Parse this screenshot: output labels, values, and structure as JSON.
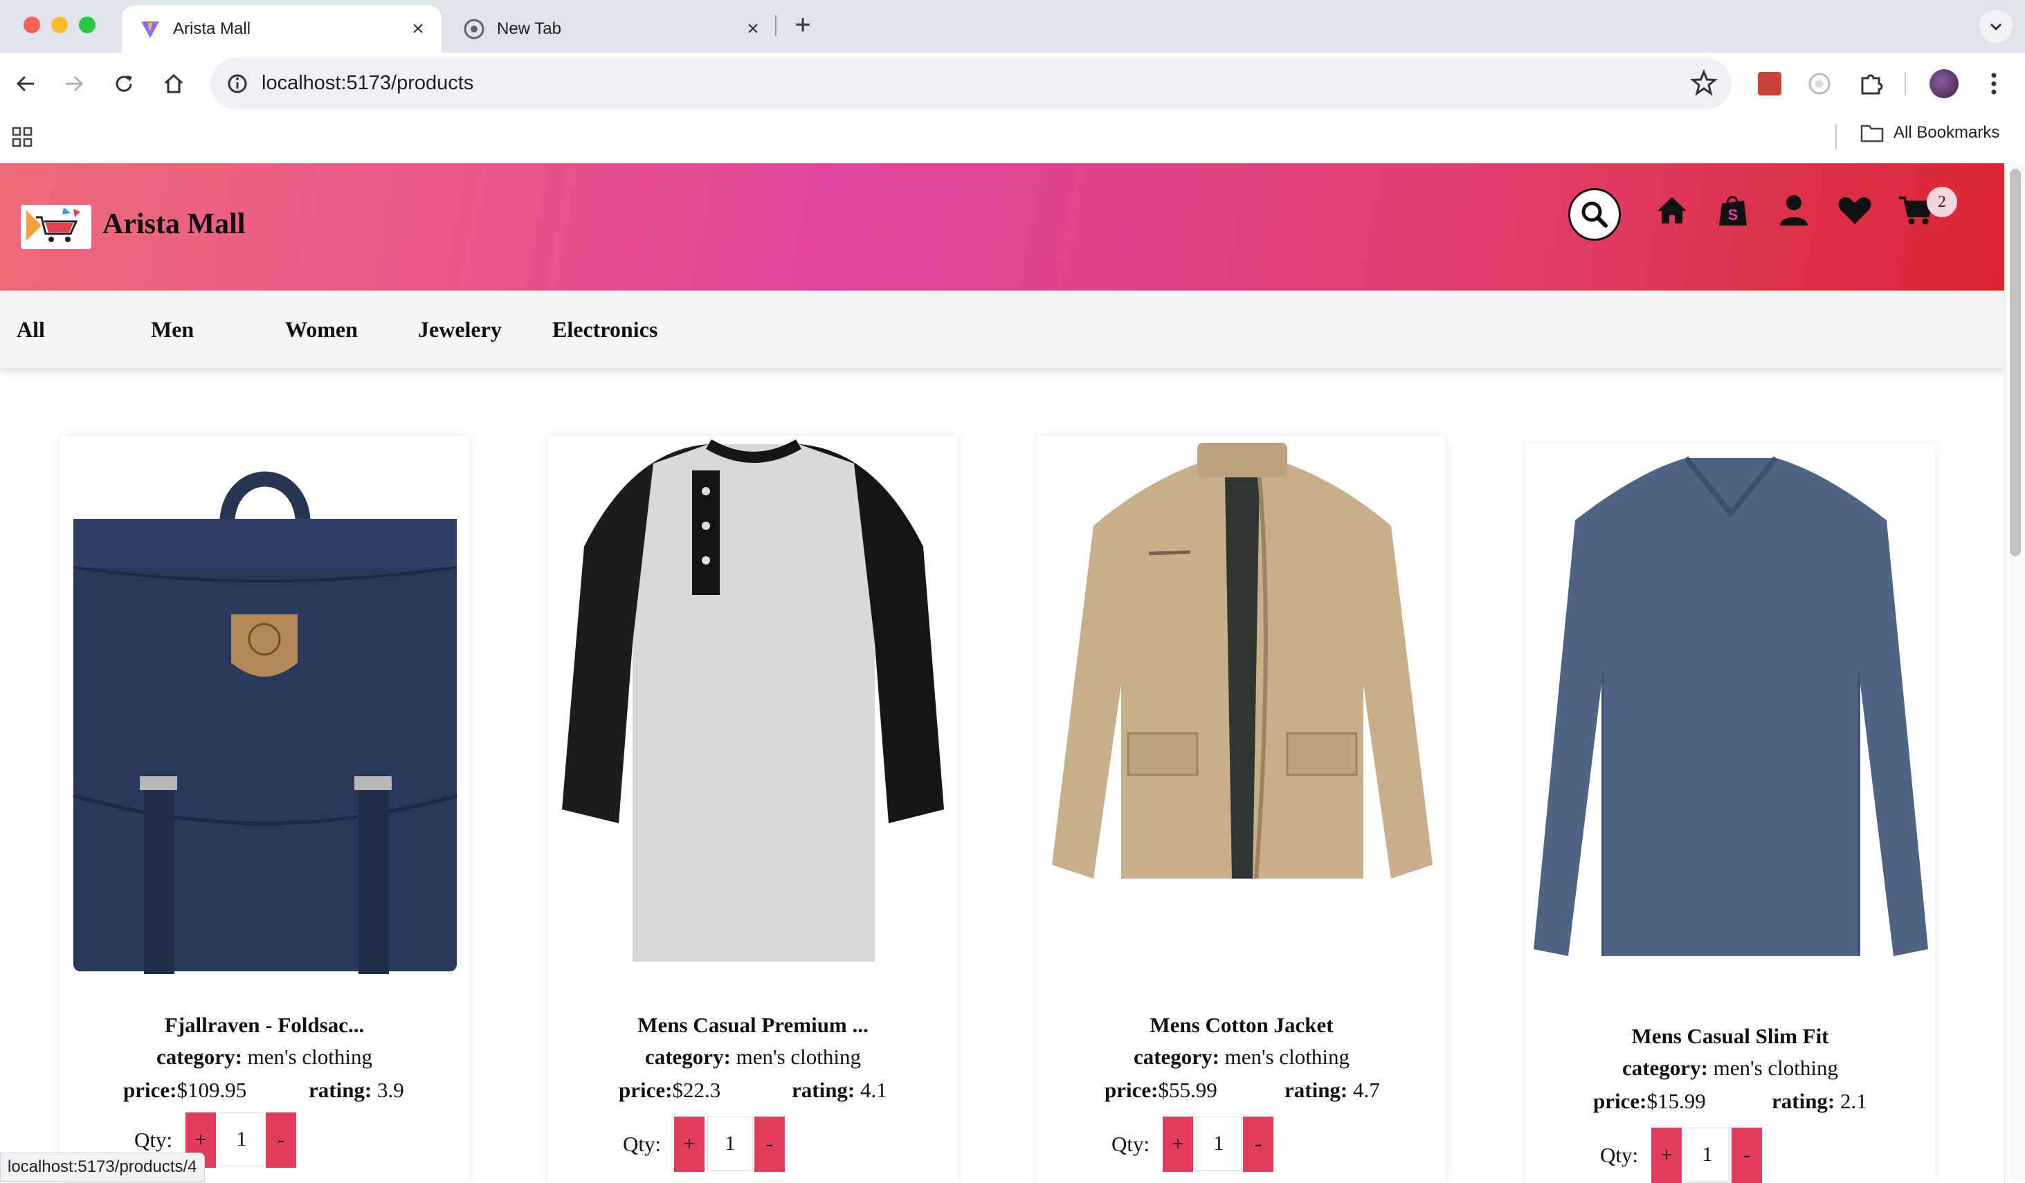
{
  "browser": {
    "tabs": [
      {
        "title": "Arista Mall",
        "active": true
      },
      {
        "title": "New Tab",
        "active": false
      }
    ],
    "url": "localhost:5173/products",
    "bookmarks_label": "All Bookmarks",
    "status_url": "localhost:5173/products/4"
  },
  "site": {
    "title": "Arista Mall",
    "cart_count": "2",
    "header_icons": [
      "search-icon",
      "home-icon",
      "shop-icon",
      "user-icon",
      "heart-icon",
      "cart-icon"
    ]
  },
  "categories": [
    "All",
    "Men",
    "Women",
    "Jewelery",
    "Electronics"
  ],
  "products": [
    {
      "name": "Fjallraven - Foldsac...",
      "category_label": "category:",
      "category": "men's clothing",
      "price_label": "price:",
      "price": "$109.95",
      "rating_label": "rating:",
      "rating": "3.9",
      "qty_label": "Qty:",
      "qty": "1",
      "plus": "+",
      "minus": "-"
    },
    {
      "name": "Mens Casual Premium ...",
      "category_label": "category:",
      "category": "men's clothing",
      "price_label": "price:",
      "price": "$22.3",
      "rating_label": "rating:",
      "rating": "4.1",
      "qty_label": "Qty:",
      "qty": "1",
      "plus": "+",
      "minus": "-"
    },
    {
      "name": "Mens Cotton Jacket",
      "category_label": "category:",
      "category": "men's clothing",
      "price_label": "price:",
      "price": "$55.99",
      "rating_label": "rating:",
      "rating": "4.7",
      "qty_label": "Qty:",
      "qty": "1",
      "plus": "+",
      "minus": "-"
    },
    {
      "name": "Mens Casual Slim Fit",
      "category_label": "category:",
      "category": "men's clothing",
      "price_label": "price:",
      "price": "$15.99",
      "rating_label": "rating:",
      "rating": "2.1",
      "qty_label": "Qty:",
      "qty": "1",
      "plus": "+",
      "minus": "-"
    }
  ],
  "colors": {
    "header_gradient_start": "#ee6b78",
    "header_gradient_mid": "#e0459d",
    "header_gradient_end": "#d9252f",
    "qty_button": "#e23d5a",
    "nav_background": "#f4f4f2"
  }
}
